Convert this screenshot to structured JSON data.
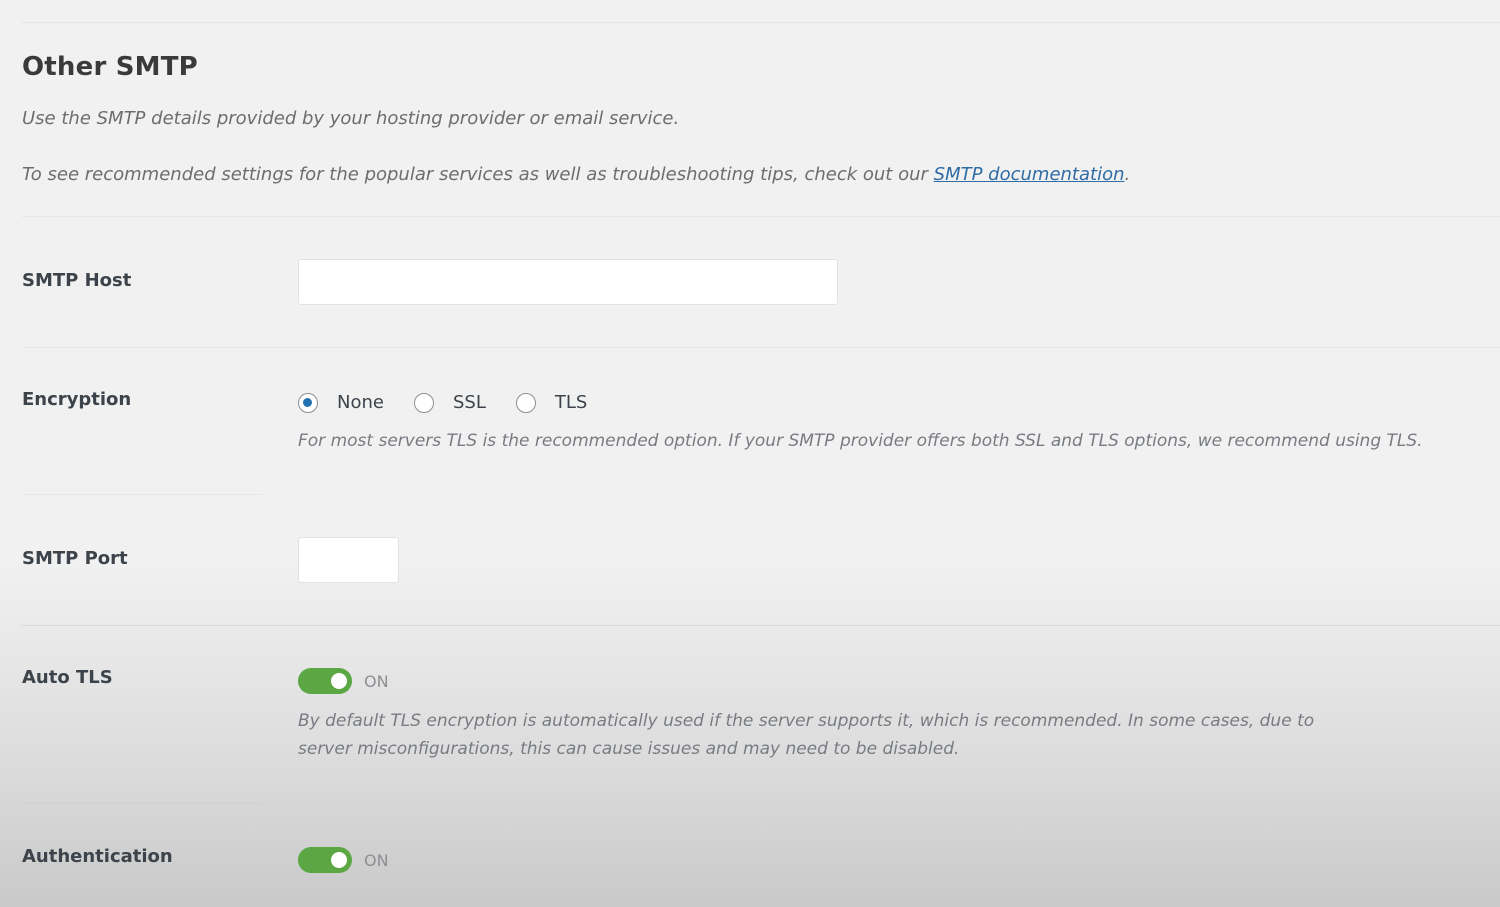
{
  "section": {
    "title": "Other SMTP",
    "description": "Use the SMTP details provided by your hosting provider or email service.",
    "docs_prefix": "To see recommended settings for the popular services as well as troubleshooting tips, check out our ",
    "docs_link": "SMTP documentation",
    "docs_suffix": "."
  },
  "smtp_host": {
    "label": "SMTP Host",
    "value": "",
    "placeholder": ""
  },
  "encryption": {
    "label": "Encryption",
    "selected": "None",
    "options": [
      "None",
      "SSL",
      "TLS"
    ],
    "help": "For most servers TLS is the recommended option. If your SMTP provider offers both SSL and TLS options, we recommend using TLS."
  },
  "smtp_port": {
    "label": "SMTP Port",
    "value": ""
  },
  "auto_tls": {
    "label": "Auto TLS",
    "state": "ON",
    "enabled": true,
    "help": "By default TLS encryption is automatically used if the server supports it, which is recommended. In some cases, due to server misconfigurations, this can cause issues and may need to be disabled."
  },
  "authentication": {
    "label": "Authentication",
    "state": "ON",
    "enabled": true
  },
  "colors": {
    "toggle_on": "#5aa744",
    "radio_checked": "#2271b1",
    "link": "#2f6ba5"
  }
}
